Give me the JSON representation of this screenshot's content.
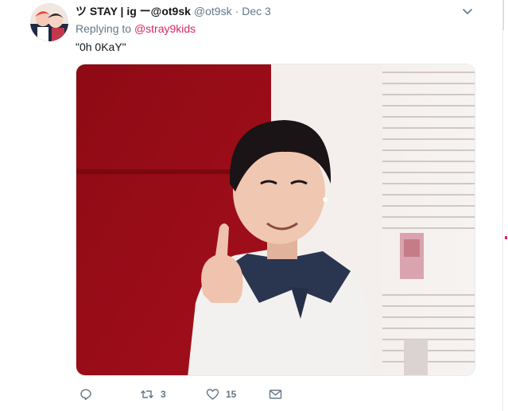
{
  "tweet": {
    "display_name": "ツ STAY | ig ー@ot9sk",
    "handle": "@ot9sk",
    "separator": "·",
    "time": "Dec 3",
    "replying_prefix": "Replying to",
    "replying_to": "@stray9kids",
    "text": "\"0h 0KaY\"",
    "media_icon": "photo-gif",
    "actions": {
      "reply_icon": "reply-icon",
      "retweet_icon": "retweet-icon",
      "retweet_count": "3",
      "like_icon": "heart-icon",
      "like_count": "15",
      "dm_icon": "envelope-icon"
    }
  },
  "colors": {
    "mention": "#e0245e",
    "secondary_text": "#657786",
    "primary_text": "#14171a",
    "accent": "#e0245e"
  }
}
